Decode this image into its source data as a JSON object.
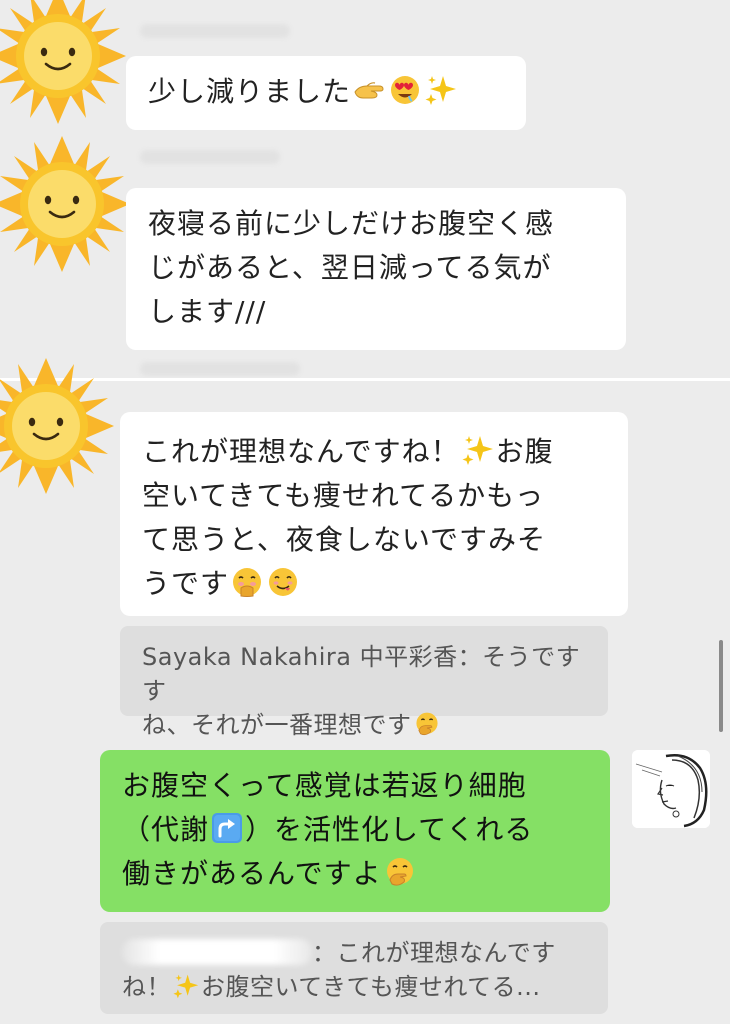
{
  "messages": [
    {
      "type": "incoming",
      "text": "少し減りました",
      "emojis": [
        "pinching-hand-emoji",
        "heart-eyes-emoji",
        "sparkles-emoji"
      ]
    },
    {
      "type": "incoming",
      "line1": "夜寝る前に少しだけお腹空く感",
      "line2": "じがあると、翌日減ってる気が",
      "line3": "します///"
    },
    {
      "type": "incoming",
      "line1a": "これが理想なんですね！",
      "line1b": "お腹",
      "line2": "空いてきても痩せれてるかもっ",
      "line3": "て思うと、夜食しないですみそ",
      "line4": "うです"
    }
  ],
  "reply_quote_1": {
    "author": "Sayaka Nakahira 中平彩香",
    "line1": "：そうですす",
    "line1_text": "Sayaka Nakahira 中平彩香：そうですす",
    "line2": "ね、それが一番理想です"
  },
  "outgoing": {
    "line1": "お腹空くって感覚は若返り細胞",
    "line2a": "（代謝",
    "line2b": "）を活性化してくれる",
    "line3": "働きがあるんですよ"
  },
  "reply_quote_2": {
    "line1": "：これが理想なんです",
    "line2a": "ね！",
    "line2b": "お腹空いてきても痩せれてる..."
  },
  "colors": {
    "background": "#ececec",
    "incoming_bubble": "#ffffff",
    "outgoing_bubble": "#85e065",
    "quote_bubble": "#dedede",
    "sun_avatar": "#f9c52c"
  },
  "icons": [
    "sun-smiley-avatar-icon",
    "sketch-portrait-avatar-icon",
    "up-arrow-emoji",
    "thinking-hand-emoji"
  ]
}
